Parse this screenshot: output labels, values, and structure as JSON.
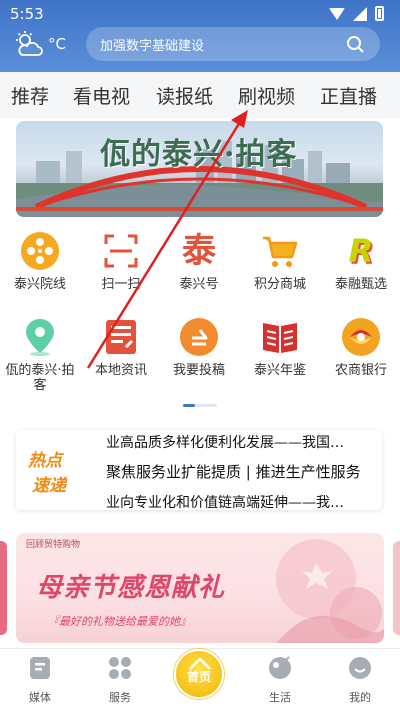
{
  "status_bar": {
    "time": "5:53"
  },
  "header": {
    "weather_unit": "°C",
    "search_placeholder": "加强数字基础建设"
  },
  "tabs": [
    "推荐",
    "看电视",
    "读报纸",
    "刷视频",
    "正直播"
  ],
  "banner": {
    "title": "佤的泰兴·拍客"
  },
  "grid": [
    {
      "label": "泰兴院线",
      "icon": "film-reel-icon"
    },
    {
      "label": "扫一扫",
      "icon": "scan-icon"
    },
    {
      "label": "泰兴号",
      "icon": "taixing-char-icon",
      "glyph": "泰"
    },
    {
      "label": "积分商城",
      "icon": "shopping-cart-icon"
    },
    {
      "label": "泰融甄选",
      "icon": "r-logo-icon",
      "glyph": "R"
    },
    {
      "label": "佤的泰兴·拍客",
      "icon": "location-pin-icon"
    },
    {
      "label": "本地资讯",
      "icon": "document-icon"
    },
    {
      "label": "我要投稿",
      "icon": "submit-arrow-icon"
    },
    {
      "label": "泰兴年鉴",
      "icon": "open-book-icon"
    },
    {
      "label": "农商银行",
      "icon": "bank-logo-icon"
    }
  ],
  "news": {
    "badge_line1": "热点",
    "badge_line2": "速递",
    "headlines": [
      "业高品质多样化便利化发展——我国…",
      "聚焦服务业扩能提质 | 推进生产性服务",
      "业向专业化和价值链高端延伸——我…"
    ]
  },
  "promo": {
    "brand": "回顾贸特购物",
    "title": "母亲节感恩献礼",
    "subtitle": "『最好的礼物送给最爱的她』"
  },
  "bottom_nav": [
    {
      "label": "媒体",
      "icon": "media-icon"
    },
    {
      "label": "服务",
      "icon": "services-icon"
    },
    {
      "label": "首页",
      "icon": "home-icon"
    },
    {
      "label": "生活",
      "icon": "life-icon"
    },
    {
      "label": "我的",
      "icon": "profile-icon"
    }
  ],
  "colors": {
    "header_blue": "#3f73c8",
    "annotation_red": "#e02020",
    "news_orange": "#f08a12",
    "promo_pink": "#e0466a"
  }
}
